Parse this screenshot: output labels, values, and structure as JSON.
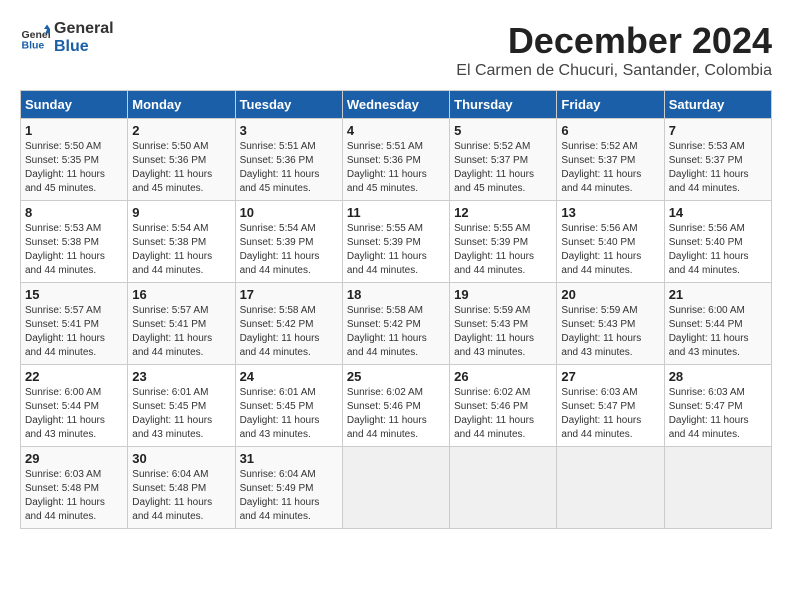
{
  "header": {
    "logo_line1": "General",
    "logo_line2": "Blue",
    "title": "December 2024",
    "subtitle": "El Carmen de Chucuri, Santander, Colombia"
  },
  "columns": [
    "Sunday",
    "Monday",
    "Tuesday",
    "Wednesday",
    "Thursday",
    "Friday",
    "Saturday"
  ],
  "weeks": [
    [
      {
        "day": "1",
        "info": "Sunrise: 5:50 AM\nSunset: 5:35 PM\nDaylight: 11 hours\nand 45 minutes."
      },
      {
        "day": "2",
        "info": "Sunrise: 5:50 AM\nSunset: 5:36 PM\nDaylight: 11 hours\nand 45 minutes."
      },
      {
        "day": "3",
        "info": "Sunrise: 5:51 AM\nSunset: 5:36 PM\nDaylight: 11 hours\nand 45 minutes."
      },
      {
        "day": "4",
        "info": "Sunrise: 5:51 AM\nSunset: 5:36 PM\nDaylight: 11 hours\nand 45 minutes."
      },
      {
        "day": "5",
        "info": "Sunrise: 5:52 AM\nSunset: 5:37 PM\nDaylight: 11 hours\nand 45 minutes."
      },
      {
        "day": "6",
        "info": "Sunrise: 5:52 AM\nSunset: 5:37 PM\nDaylight: 11 hours\nand 44 minutes."
      },
      {
        "day": "7",
        "info": "Sunrise: 5:53 AM\nSunset: 5:37 PM\nDaylight: 11 hours\nand 44 minutes."
      }
    ],
    [
      {
        "day": "8",
        "info": "Sunrise: 5:53 AM\nSunset: 5:38 PM\nDaylight: 11 hours\nand 44 minutes."
      },
      {
        "day": "9",
        "info": "Sunrise: 5:54 AM\nSunset: 5:38 PM\nDaylight: 11 hours\nand 44 minutes."
      },
      {
        "day": "10",
        "info": "Sunrise: 5:54 AM\nSunset: 5:39 PM\nDaylight: 11 hours\nand 44 minutes."
      },
      {
        "day": "11",
        "info": "Sunrise: 5:55 AM\nSunset: 5:39 PM\nDaylight: 11 hours\nand 44 minutes."
      },
      {
        "day": "12",
        "info": "Sunrise: 5:55 AM\nSunset: 5:39 PM\nDaylight: 11 hours\nand 44 minutes."
      },
      {
        "day": "13",
        "info": "Sunrise: 5:56 AM\nSunset: 5:40 PM\nDaylight: 11 hours\nand 44 minutes."
      },
      {
        "day": "14",
        "info": "Sunrise: 5:56 AM\nSunset: 5:40 PM\nDaylight: 11 hours\nand 44 minutes."
      }
    ],
    [
      {
        "day": "15",
        "info": "Sunrise: 5:57 AM\nSunset: 5:41 PM\nDaylight: 11 hours\nand 44 minutes."
      },
      {
        "day": "16",
        "info": "Sunrise: 5:57 AM\nSunset: 5:41 PM\nDaylight: 11 hours\nand 44 minutes."
      },
      {
        "day": "17",
        "info": "Sunrise: 5:58 AM\nSunset: 5:42 PM\nDaylight: 11 hours\nand 44 minutes."
      },
      {
        "day": "18",
        "info": "Sunrise: 5:58 AM\nSunset: 5:42 PM\nDaylight: 11 hours\nand 44 minutes."
      },
      {
        "day": "19",
        "info": "Sunrise: 5:59 AM\nSunset: 5:43 PM\nDaylight: 11 hours\nand 43 minutes."
      },
      {
        "day": "20",
        "info": "Sunrise: 5:59 AM\nSunset: 5:43 PM\nDaylight: 11 hours\nand 43 minutes."
      },
      {
        "day": "21",
        "info": "Sunrise: 6:00 AM\nSunset: 5:44 PM\nDaylight: 11 hours\nand 43 minutes."
      }
    ],
    [
      {
        "day": "22",
        "info": "Sunrise: 6:00 AM\nSunset: 5:44 PM\nDaylight: 11 hours\nand 43 minutes."
      },
      {
        "day": "23",
        "info": "Sunrise: 6:01 AM\nSunset: 5:45 PM\nDaylight: 11 hours\nand 43 minutes."
      },
      {
        "day": "24",
        "info": "Sunrise: 6:01 AM\nSunset: 5:45 PM\nDaylight: 11 hours\nand 43 minutes."
      },
      {
        "day": "25",
        "info": "Sunrise: 6:02 AM\nSunset: 5:46 PM\nDaylight: 11 hours\nand 44 minutes."
      },
      {
        "day": "26",
        "info": "Sunrise: 6:02 AM\nSunset: 5:46 PM\nDaylight: 11 hours\nand 44 minutes."
      },
      {
        "day": "27",
        "info": "Sunrise: 6:03 AM\nSunset: 5:47 PM\nDaylight: 11 hours\nand 44 minutes."
      },
      {
        "day": "28",
        "info": "Sunrise: 6:03 AM\nSunset: 5:47 PM\nDaylight: 11 hours\nand 44 minutes."
      }
    ],
    [
      {
        "day": "29",
        "info": "Sunrise: 6:03 AM\nSunset: 5:48 PM\nDaylight: 11 hours\nand 44 minutes."
      },
      {
        "day": "30",
        "info": "Sunrise: 6:04 AM\nSunset: 5:48 PM\nDaylight: 11 hours\nand 44 minutes."
      },
      {
        "day": "31",
        "info": "Sunrise: 6:04 AM\nSunset: 5:49 PM\nDaylight: 11 hours\nand 44 minutes."
      },
      null,
      null,
      null,
      null
    ]
  ]
}
